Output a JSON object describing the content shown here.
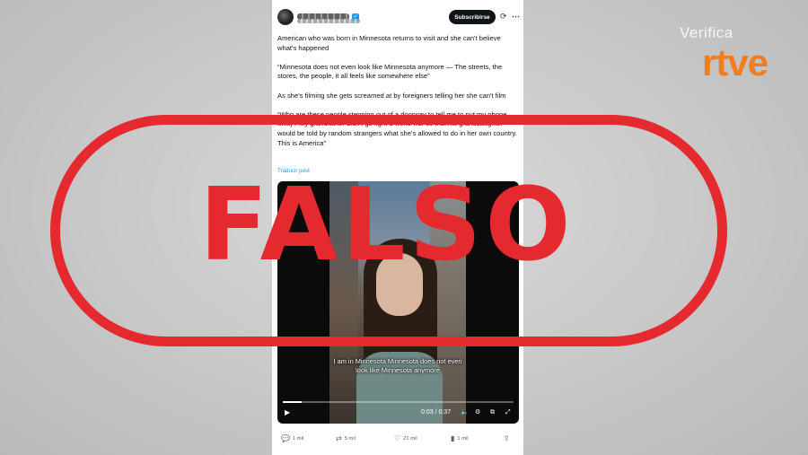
{
  "post": {
    "subscribe_label": "Subscribirse",
    "paragraphs": [
      "American who was born in Minnesota returns to visit and she can't believe what's happened",
      "“Minnesota does not even look like Minnesota anymore — The streets, the stores, the people, it all feels like somewhere else”",
      "As she's filming she gets screamed at by foreigners telling her she can't film",
      "“Who are these people stepping out of a doorway to tell me to put my phone away? My grandfather didn't go fight a world war so that his granddaughter would be told by random strangers what she's allowed to do in her own country. This is America”"
    ],
    "translate_label": "Traducir post"
  },
  "video": {
    "caption": "I am in Minnesota Minnesota does not even look like Minnesota anymore",
    "time": "0:03 / 0:37",
    "progress": 0.08
  },
  "actions": {
    "replies": "1 mil",
    "reposts": "5 mil",
    "likes": "21 mil",
    "views": "1 mil"
  },
  "stamp": {
    "text": "FALSO",
    "color": "#e52a2f"
  },
  "logo": {
    "top": "Verifica",
    "bottom": "rtve",
    "color": "#f07d1f"
  },
  "icons": {
    "play": "play-icon",
    "volume": "volume-icon",
    "settings": "gear-icon",
    "pip": "pip-icon",
    "fullscreen": "fullscreen-icon",
    "reply": "reply-icon",
    "repost": "repost-icon",
    "like": "heart-icon",
    "views": "views-icon",
    "share": "share-icon"
  }
}
